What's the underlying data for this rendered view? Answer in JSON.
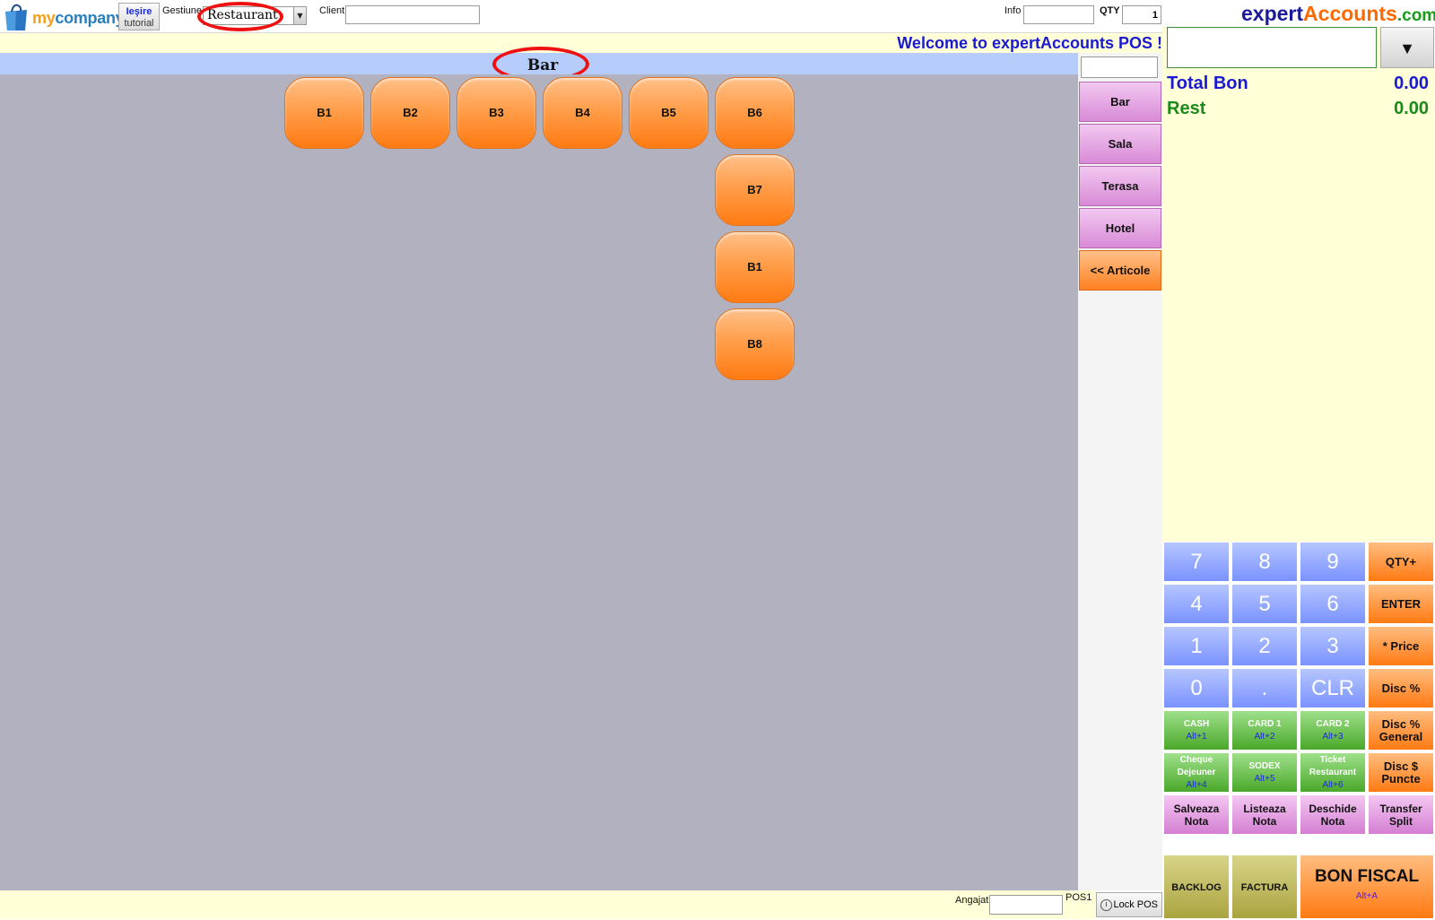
{
  "header": {
    "logo_text_my": "my",
    "logo_text_company": "company",
    "exit_label": "Ieşire",
    "exit_sub": "tutorial",
    "gestiune_label": "Gestiune",
    "gestiune_value": "Restaurant",
    "client_label": "Client",
    "client_value": "",
    "info_label": "Info",
    "info_value": "",
    "qty_label": "QTY",
    "qty_value": "1",
    "brand_expert": "expert",
    "brand_accounts": "Accounts",
    "brand_com": ".com"
  },
  "welcome": "Welcome to expertAccounts POS !",
  "area": {
    "title": "Bar",
    "tables": [
      "B1",
      "B2",
      "B3",
      "B4",
      "B5",
      "B6",
      "B7",
      "B1",
      "B8"
    ]
  },
  "zones": {
    "search_value": "",
    "items": [
      "Bar",
      "Sala",
      "Terasa",
      "Hotel"
    ],
    "articole": "<< Articole"
  },
  "summary": {
    "total_label": "Total Bon",
    "total_value": "0.00",
    "rest_label": "Rest",
    "rest_value": "0.00",
    "colors": {
      "total": "#1a1ad0",
      "rest": "#1a8a1a"
    }
  },
  "keypad": {
    "digits": [
      "7",
      "8",
      "9",
      "4",
      "5",
      "6",
      "1",
      "2",
      "3",
      "0",
      ".",
      "CLR"
    ],
    "ops": [
      "QTY+",
      "ENTER",
      "* Price",
      "Disc %"
    ],
    "disc_general": [
      "Disc %",
      "General"
    ],
    "disc_puncte": [
      "Disc $",
      "Puncte"
    ],
    "payments": [
      {
        "label": "CASH",
        "shortcut": "Alt+1"
      },
      {
        "label": "CARD 1",
        "shortcut": "Alt+2"
      },
      {
        "label": "CARD 2",
        "shortcut": "Alt+3"
      },
      {
        "label_1": "Cheque",
        "label_2": "Dejeuner",
        "shortcut": "Alt+4"
      },
      {
        "label": "SODEX",
        "shortcut": "Alt+5"
      },
      {
        "label_1": "Ticket",
        "label_2": "Restaurant",
        "shortcut": "Alt+6"
      }
    ],
    "notes": [
      [
        "Salveaza",
        "Nota"
      ],
      [
        "Listeaza",
        "Nota"
      ],
      [
        "Deschide",
        "Nota"
      ],
      [
        "Transfer",
        "Split"
      ]
    ],
    "backlog": "BACKLOG",
    "factura": "FACTURA",
    "bon_fiscal": "BON FISCAL",
    "bon_fiscal_shortcut": "Alt+A"
  },
  "footer": {
    "angajat_label": "Angajat",
    "angajat_value": "",
    "pos_label": "POS1",
    "lock_label": "Lock POS"
  }
}
